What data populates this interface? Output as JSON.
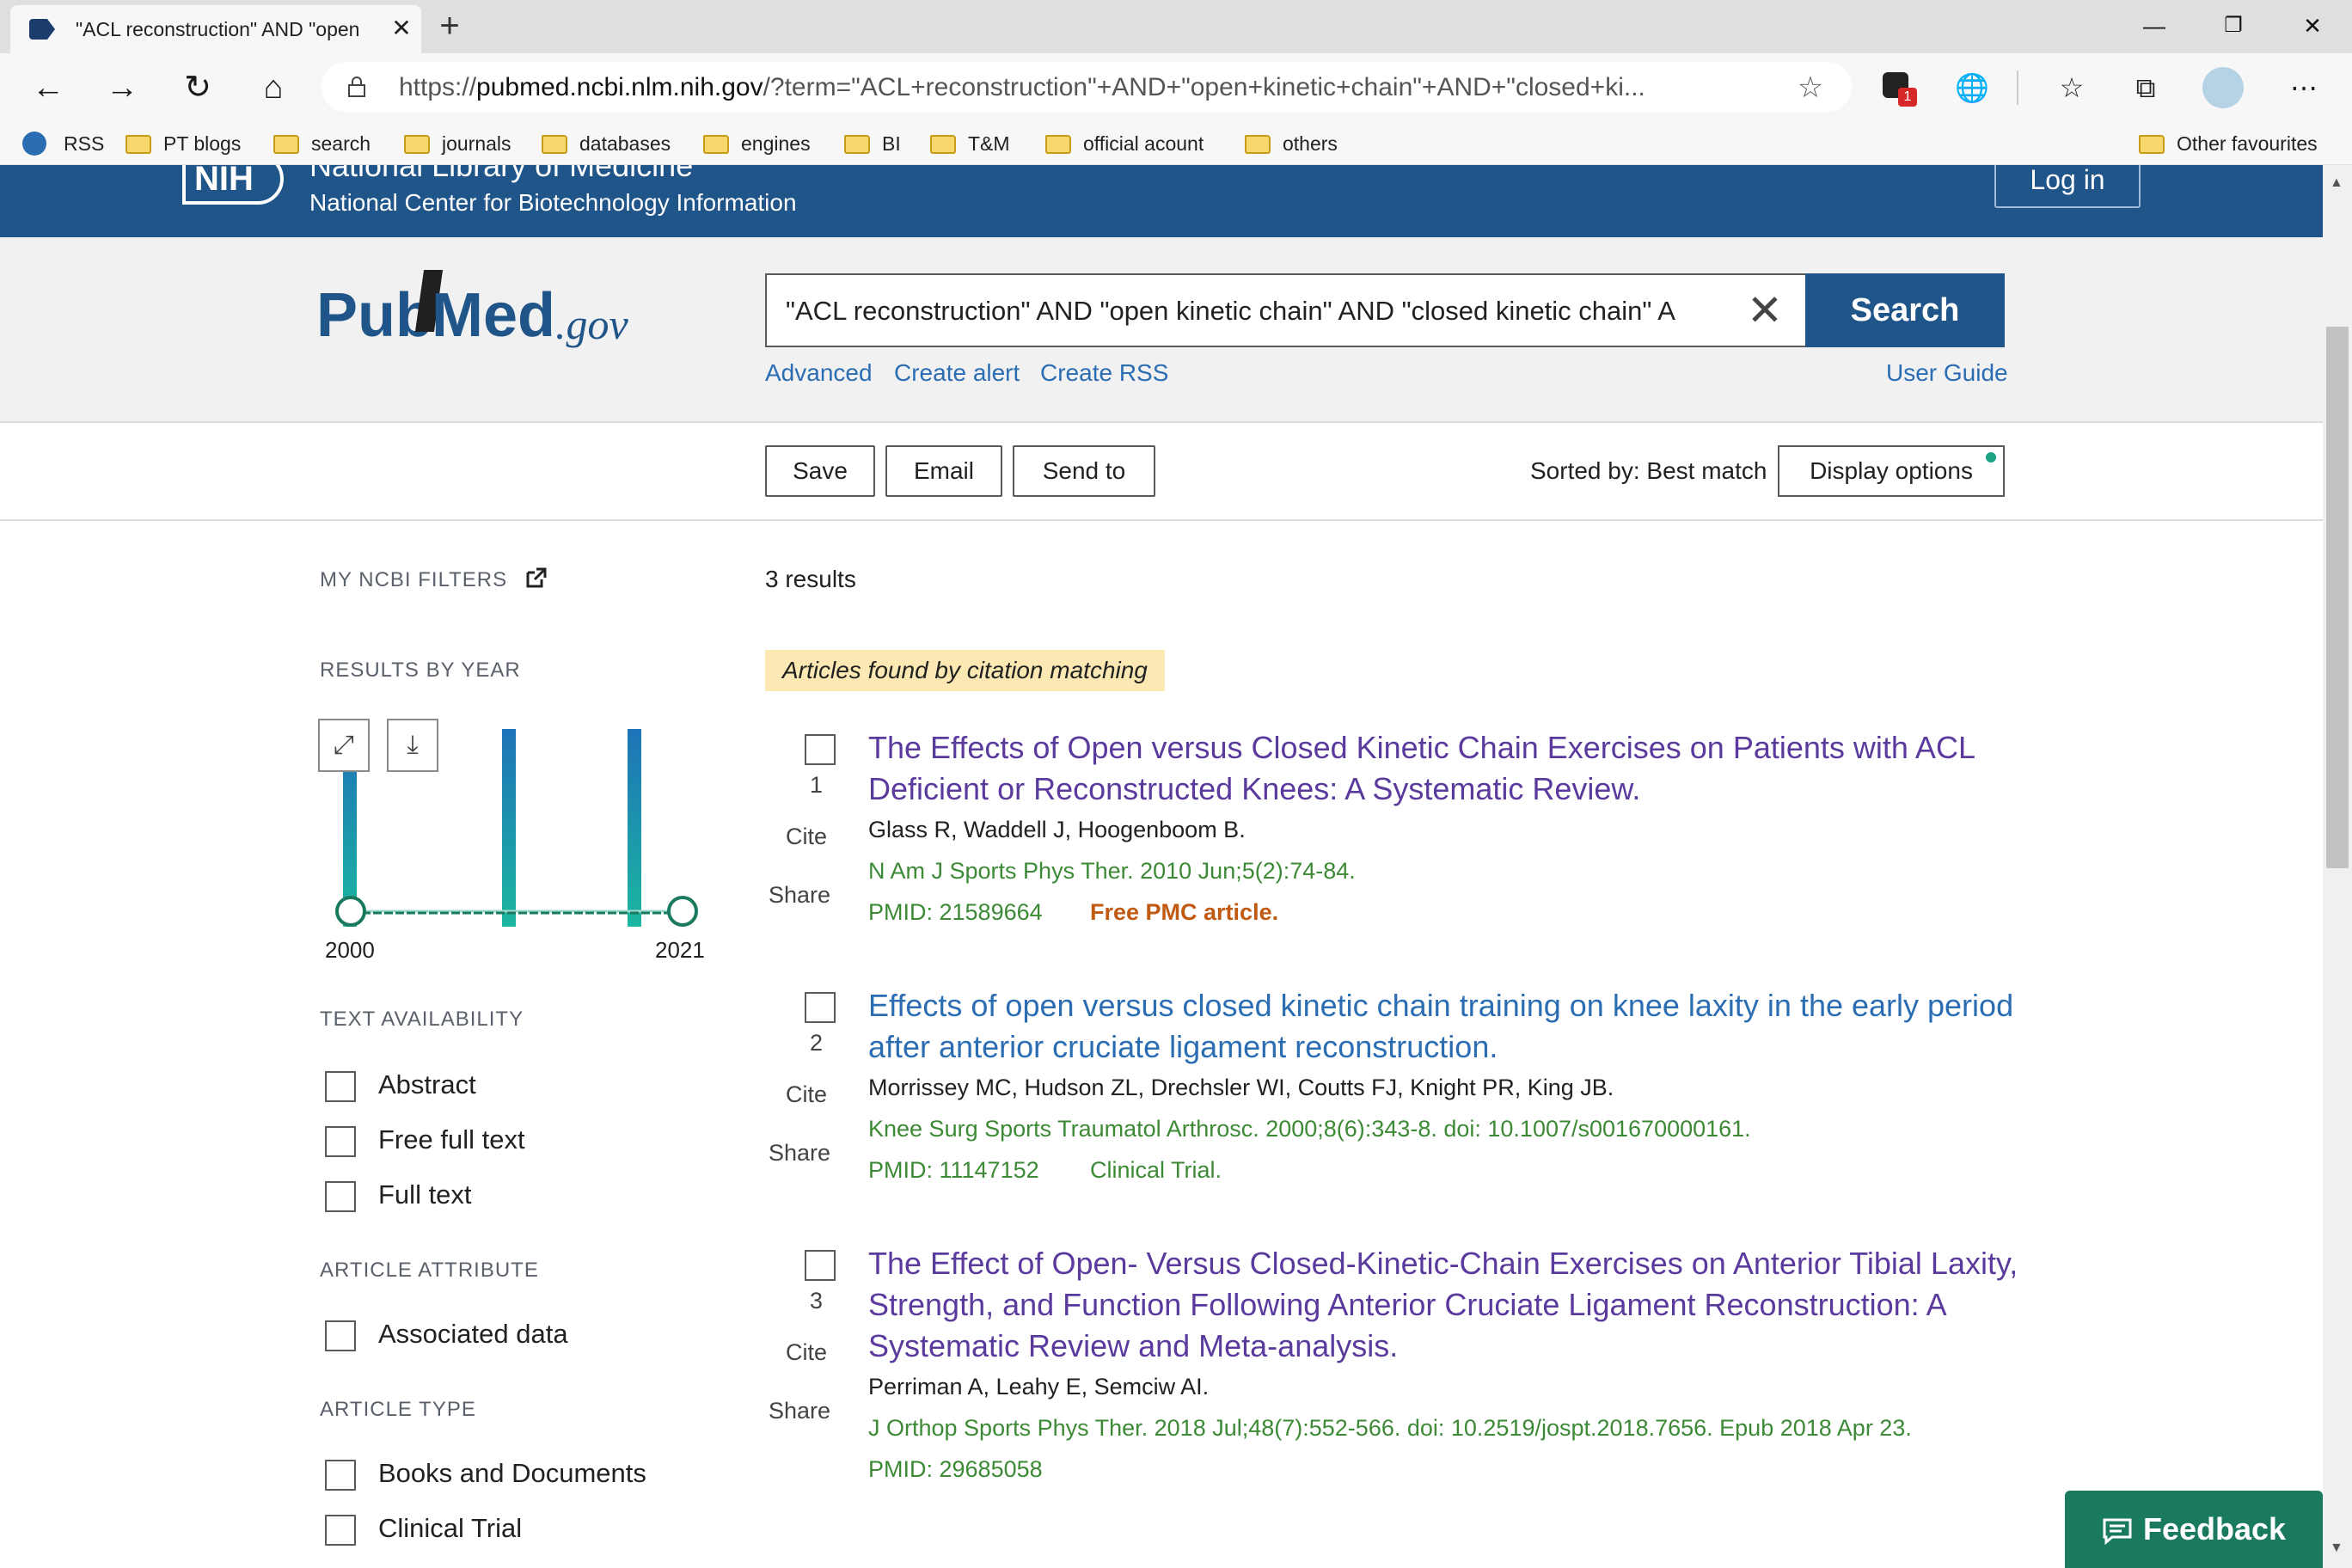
{
  "browser": {
    "tab_title": "\"ACL reconstruction\" AND \"open",
    "url_prefix": "https://",
    "url_domain": "pubmed.ncbi.nlm.nih.gov",
    "url_rest": "/?term=\"ACL+reconstruction\"+AND+\"open+kinetic+chain\"+AND+\"closed+ki...",
    "bookmarks": [
      "RSS",
      "PT blogs",
      "search",
      "journals",
      "databases",
      "engines",
      "BI",
      "T&M",
      "official acount",
      "others"
    ],
    "other_favourites": "Other favourites",
    "extension_badge": "1"
  },
  "nih": {
    "logo": "NIH",
    "top_line": "National Library of Medicine",
    "subtitle": "National Center for Biotechnology Information",
    "login": "Log in"
  },
  "search": {
    "logo_pub": "Pub",
    "logo_med": "Med",
    "logo_gov": ".gov",
    "query": "\"ACL reconstruction\" AND \"open kinetic chain\" AND \"closed kinetic chain\" A",
    "button": "Search",
    "advanced": "Advanced",
    "create_alert": "Create alert",
    "create_rss": "Create RSS",
    "user_guide": "User Guide"
  },
  "actions": {
    "save": "Save",
    "email": "Email",
    "send_to": "Send to",
    "sorted_by": "Sorted by: Best match",
    "display_options": "Display options"
  },
  "sidebar": {
    "my_filters": "MY NCBI FILTERS",
    "results_by_year": "RESULTS BY YEAR",
    "year_start": "2000",
    "year_end": "2021",
    "text_availability": "TEXT AVAILABILITY",
    "text_options": [
      "Abstract",
      "Free full text",
      "Full text"
    ],
    "article_attribute": "ARTICLE ATTRIBUTE",
    "attribute_options": [
      "Associated data"
    ],
    "article_type": "ARTICLE TYPE",
    "type_options": [
      "Books and Documents",
      "Clinical Trial"
    ]
  },
  "results": {
    "count": "3 results",
    "badge": "Articles found by citation matching",
    "cite_label": "Cite",
    "share_label": "Share",
    "items": [
      {
        "num": "1",
        "title": "The Effects of Open versus Closed Kinetic Chain Exercises on Patients with ACL Deficient or Reconstructed Knees: A Systematic Review.",
        "authors": "Glass R, Waddell J, Hoogenboom B.",
        "journal": "N Am J Sports Phys Ther. 2010 Jun;5(2):74-84.",
        "pmid": "PMID: 21589664",
        "tag": "Free PMC article."
      },
      {
        "num": "2",
        "title": "Effects of open versus closed kinetic chain training on knee laxity in the early period after anterior cruciate ligament reconstruction.",
        "authors": "Morrissey MC, Hudson ZL, Drechsler WI, Coutts FJ, Knight PR, King JB.",
        "journal": "Knee Surg Sports Traumatol Arthrosc. 2000;8(6):343-8. doi: 10.1007/s001670000161.",
        "pmid": "PMID: 11147152",
        "tag": "Clinical Trial."
      },
      {
        "num": "3",
        "title": "The Effect of Open- Versus Closed-Kinetic-Chain Exercises on Anterior Tibial Laxity, Strength, and Function Following Anterior Cruciate Ligament Reconstruction: A Systematic Review and Meta-analysis.",
        "authors": "Perriman A, Leahy E, Semciw AI.",
        "journal": "J Orthop Sports Phys Ther. 2018 Jul;48(7):552-566. doi: 10.2519/jospt.2018.7656. Epub 2018 Apr 23.",
        "pmid": "PMID: 29685058",
        "tag": ""
      }
    ]
  },
  "feedback": "Feedback",
  "colors": {
    "nih_blue": "#20558a",
    "link_blue": "#2b6db3",
    "visited_purple": "#5b3a9e",
    "journal_green": "#3c8a35",
    "free_pmc_orange": "#c05a12",
    "badge_yellow": "#fbe8b3",
    "feedback_green": "#1a7a5f"
  },
  "icons": [
    "back-arrow-icon",
    "forward-arrow-icon",
    "refresh-icon",
    "home-icon",
    "lock-icon",
    "star-icon",
    "folder-icon",
    "external-link-icon",
    "expand-icon",
    "download-icon",
    "close-icon",
    "feedback-icon"
  ]
}
